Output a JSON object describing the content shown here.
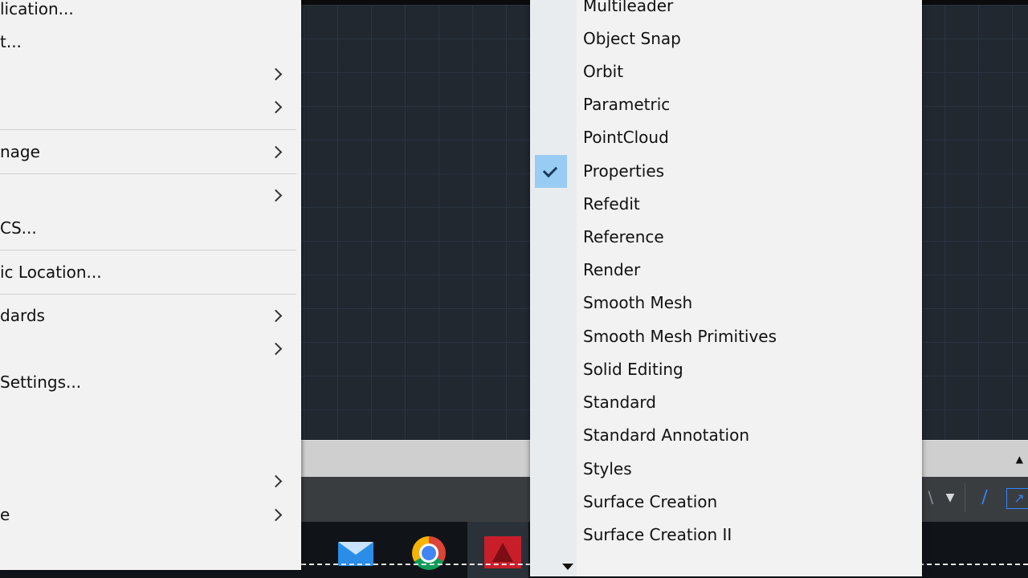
{
  "left_menu": {
    "items": [
      {
        "label": "lication...",
        "submenu": false
      },
      {
        "label": "t...",
        "submenu": false
      },
      {
        "label": "",
        "submenu": true
      },
      {
        "label": "",
        "submenu": true
      },
      {
        "label": "nage",
        "submenu": true
      },
      {
        "label": "",
        "submenu": true
      },
      {
        "label": "CS...",
        "submenu": false
      },
      {
        "label": "ic Location...",
        "submenu": false
      },
      {
        "label": "dards",
        "submenu": true
      },
      {
        "label": "",
        "submenu": true
      },
      {
        "label": "Settings...",
        "submenu": false
      },
      {
        "label": "",
        "submenu": true
      },
      {
        "label": "e",
        "submenu": true
      }
    ]
  },
  "toolbar_menu": {
    "items": [
      {
        "label": "Multileader",
        "checked": false
      },
      {
        "label": "Object Snap",
        "checked": false
      },
      {
        "label": "Orbit",
        "checked": false
      },
      {
        "label": "Parametric",
        "checked": false
      },
      {
        "label": "PointCloud",
        "checked": false
      },
      {
        "label": "Properties",
        "checked": true
      },
      {
        "label": "Refedit",
        "checked": false
      },
      {
        "label": "Reference",
        "checked": false
      },
      {
        "label": "Render",
        "checked": false
      },
      {
        "label": "Smooth Mesh",
        "checked": false
      },
      {
        "label": "Smooth Mesh Primitives",
        "checked": false
      },
      {
        "label": "Solid Editing",
        "checked": false
      },
      {
        "label": "Standard",
        "checked": false
      },
      {
        "label": "Standard Annotation",
        "checked": false
      },
      {
        "label": "Styles",
        "checked": false
      },
      {
        "label": "Surface Creation",
        "checked": false
      },
      {
        "label": "Surface Creation II",
        "checked": false
      }
    ]
  },
  "taskbar": {
    "apps": [
      "mail-icon",
      "chrome-icon",
      "autocad-icon"
    ]
  },
  "colors": {
    "menu_bg": "#f2f2f2",
    "check_highlight": "#99ccf3",
    "canvas_bg": "#212830",
    "status_accent": "#2f86ff"
  }
}
